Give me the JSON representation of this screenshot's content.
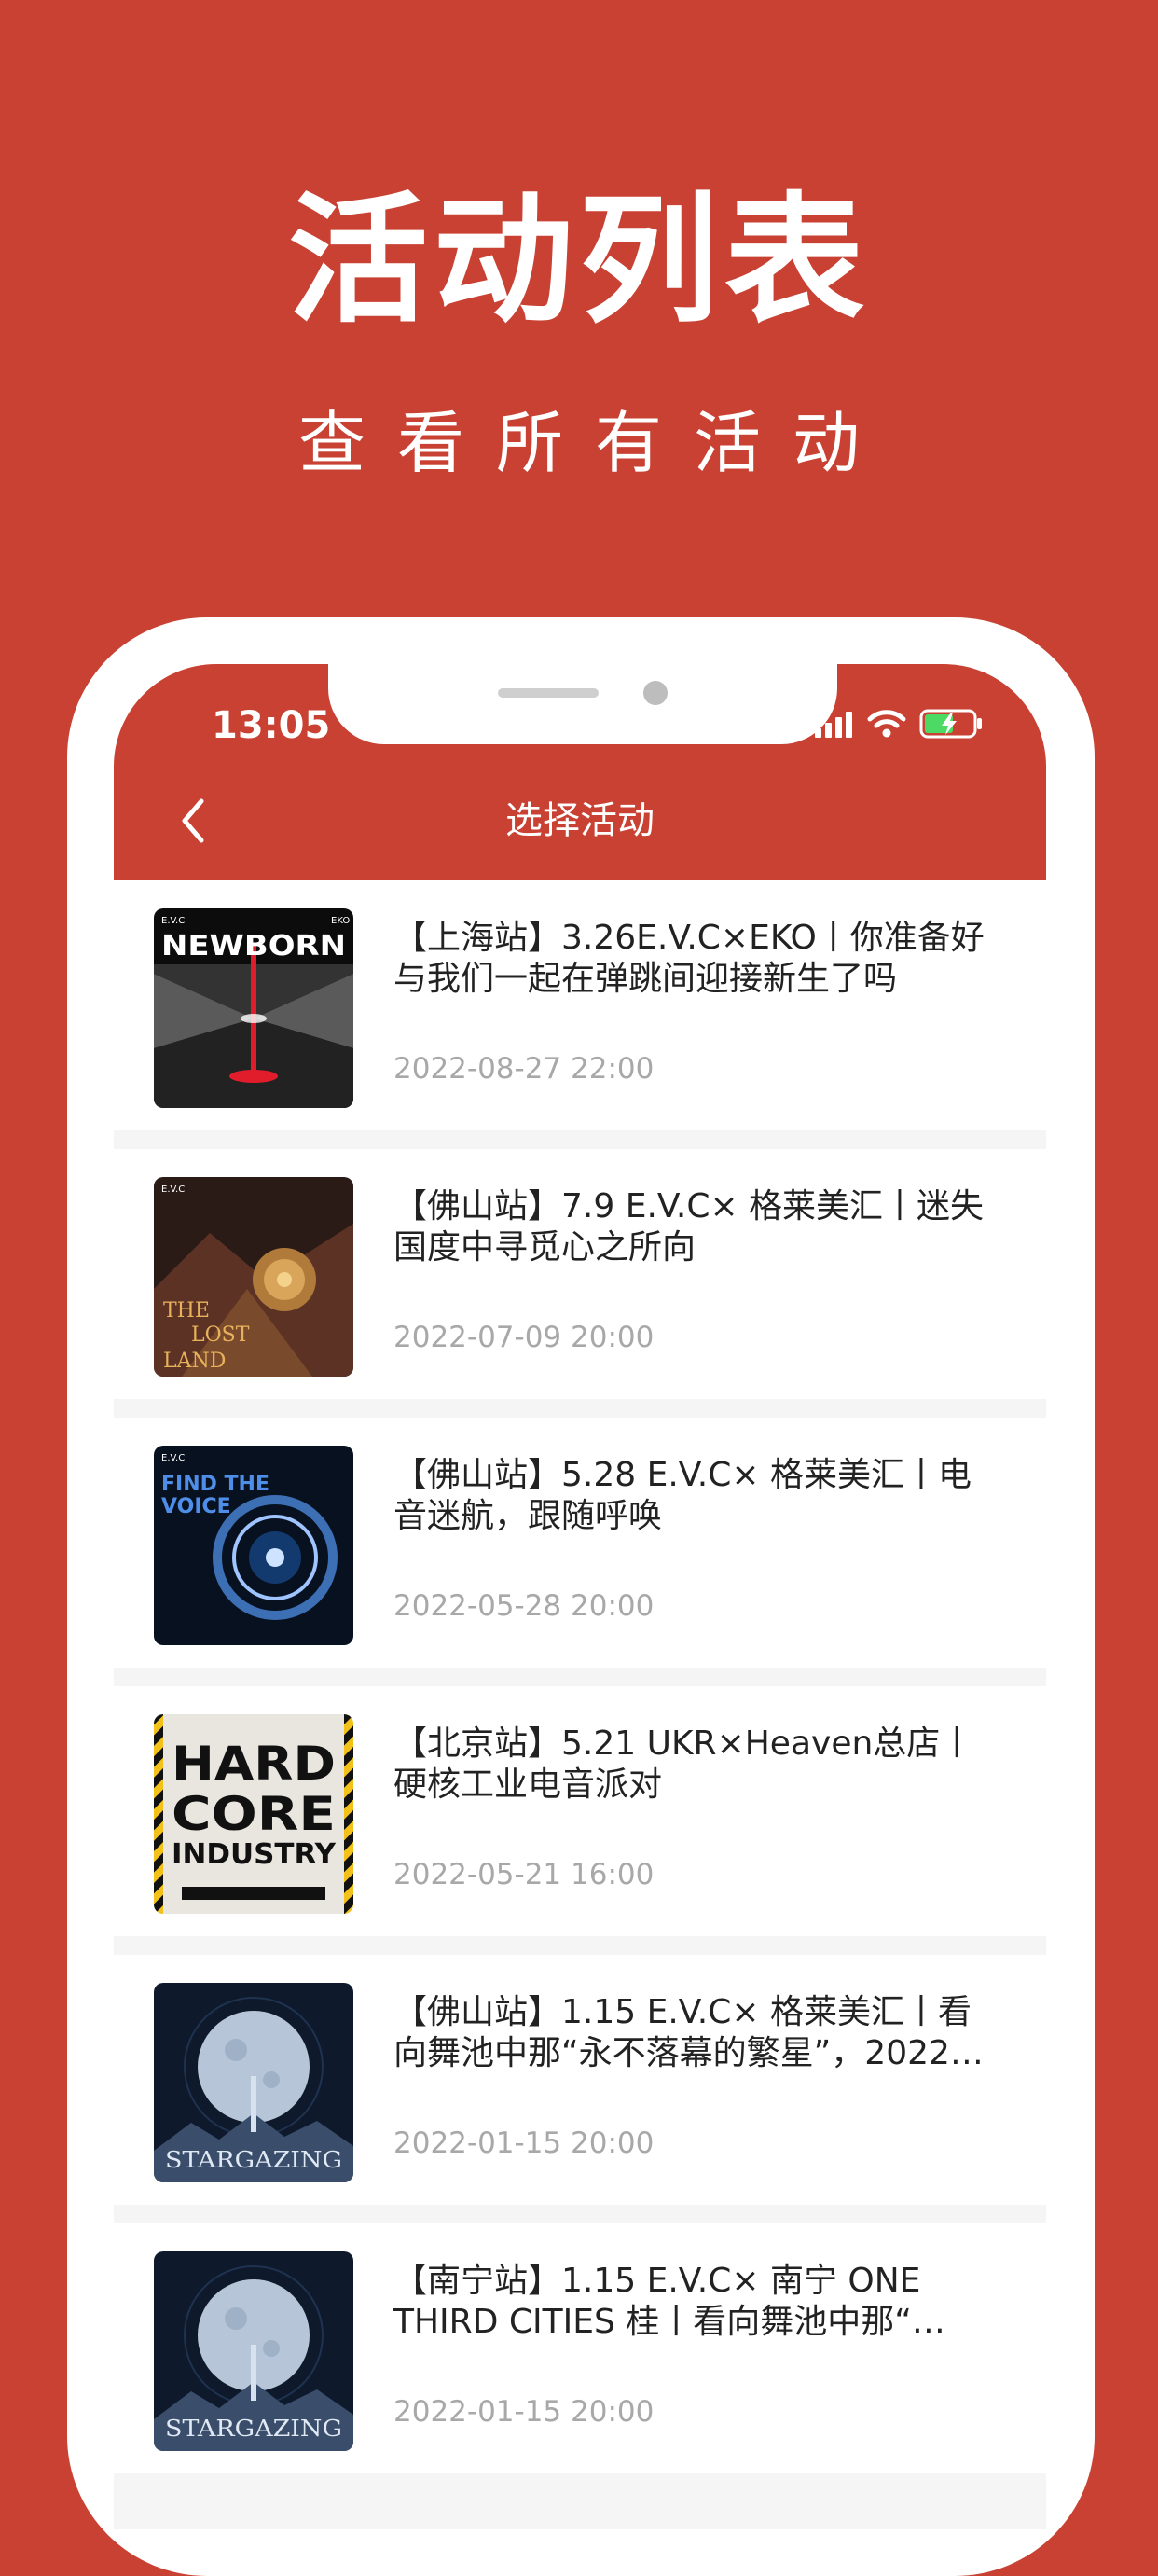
{
  "promo": {
    "title": "活动列表",
    "subtitle": "查看所有活动"
  },
  "status_bar": {
    "time": "13:05",
    "icons": [
      "signal-icon",
      "wifi-icon",
      "battery-charging-icon"
    ]
  },
  "nav": {
    "back_icon": "chevron-left-icon",
    "title": "选择活动"
  },
  "events": [
    {
      "title": "【上海站】3.26E.V.C×EKO丨你准备好与我们一起在弹跳间迎接新生了吗",
      "date": "2022-08-27 22:00",
      "poster": {
        "top_left": "E.V.C",
        "top_right": "EKO",
        "headline": "NEWBORN"
      }
    },
    {
      "title": "【佛山站】7.9 E.V.C× 格莱美汇丨迷失国度中寻觅心之所向",
      "date": "2022-07-09 20:00",
      "poster": {
        "top_left": "E.V.C",
        "headline_1": "THE",
        "headline_2": "LOST",
        "headline_3": "LAND"
      }
    },
    {
      "title": "【佛山站】5.28 E.V.C× 格莱美汇丨电音迷航，跟随呼唤",
      "date": "2022-05-28 20:00",
      "poster": {
        "top_left": "E.V.C",
        "headline_1": "FIND THE",
        "headline_2": "VOICE"
      }
    },
    {
      "title": "【北京站】5.21 UKR×Heaven总店丨硬核工业电音派对",
      "date": "2022-05-21 16:00",
      "poster": {
        "line_1": "HARD",
        "line_2": "CORE",
        "line_3": "INDUSTRY"
      }
    },
    {
      "title": "【佛山站】1.15 E.V.C× 格莱美汇丨看向舞池中那“永不落幕的繁星”，2022…",
      "date": "2022-01-15 20:00",
      "poster": {
        "headline": "STARGAZING"
      }
    },
    {
      "title": "【南宁站】1.15 E.V.C× 南宁 ONE THIRD CITIES 桂丨看向舞池中那“…",
      "date": "2022-01-15 20:00",
      "poster": {
        "headline": "STARGAZING"
      }
    }
  ],
  "colors": {
    "brand": "#C94132",
    "background": "#F5F5F5",
    "title_text": "#222222",
    "date_text": "#A8A8A8"
  }
}
